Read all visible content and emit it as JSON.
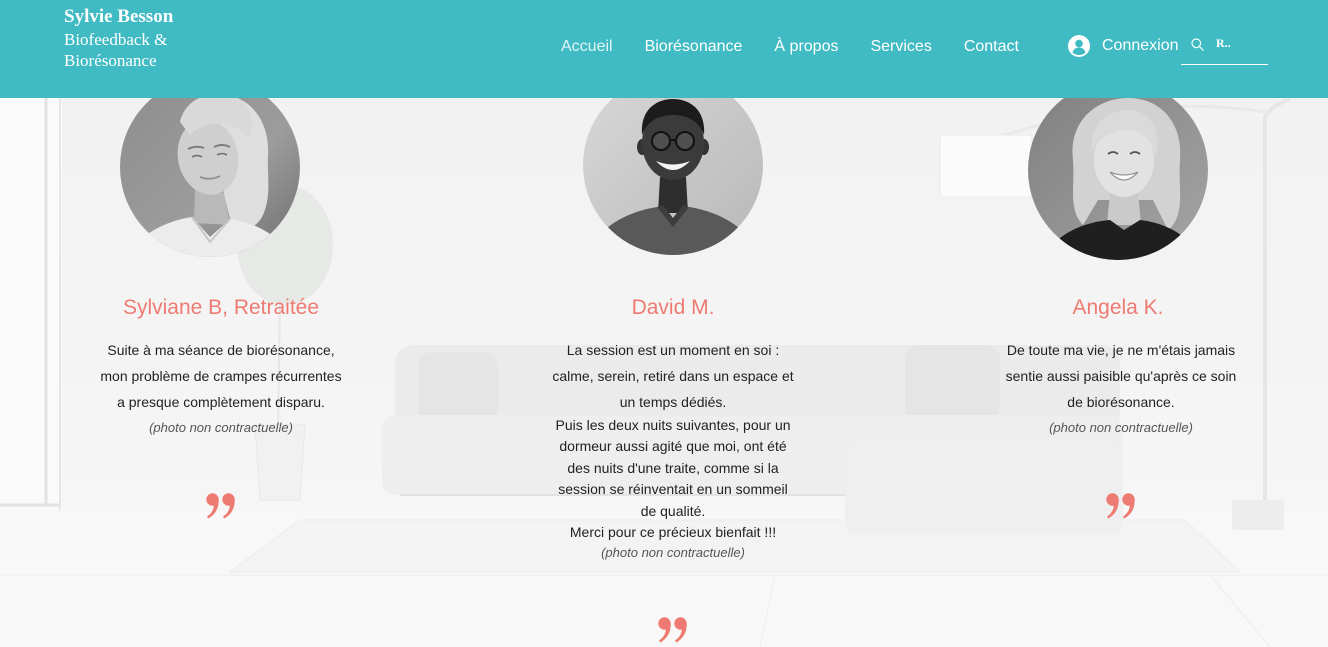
{
  "colors": {
    "header_background": "#40BBC3",
    "accent": "#EE7B72",
    "text": "#222222",
    "note": "#555555"
  },
  "header": {
    "site_name": "Sylvie Besson",
    "tagline_line1": "Biofeedback &",
    "tagline_line2": "Biorésonance",
    "nav": [
      {
        "label": "Accueil"
      },
      {
        "label": "Biorésonance"
      },
      {
        "label": "À propos"
      },
      {
        "label": "Services"
      },
      {
        "label": "Contact"
      }
    ],
    "login": {
      "label": "Connexion",
      "icon": "user-avatar-icon"
    },
    "search": {
      "icon": "search-icon",
      "placeholder": "R.."
    }
  },
  "testimonials": [
    {
      "name": "Sylviane B, Retraitée",
      "paragraphs": [
        [
          "Suite à ma séance de biorésonance,",
          "mon problème de crampes récurrentes",
          "a presque complètement disparu."
        ]
      ],
      "note": "(photo non contractuelle)",
      "quote_icon": "closing-quote-icon"
    },
    {
      "name": "David M.",
      "paragraphs": [
        [
          "La session est un moment en soi :",
          "calme, serein, retiré dans un espace et",
          "un temps dédiés."
        ],
        [
          "Puis les deux nuits suivantes, pour un",
          "dormeur aussi agité que moi, ont été",
          "des nuits d'une traite, comme si la",
          "session se réinventait en un sommeil",
          "de qualité."
        ],
        [
          "Merci pour ce précieux bienfait !!!"
        ]
      ],
      "note": "(photo non contractuelle)",
      "quote_icon": "closing-quote-icon"
    },
    {
      "name": "Angela K.",
      "paragraphs": [
        [
          "De toute ma vie, je ne m'étais jamais",
          "sentie aussi paisible qu'après ce soin",
          "de biorésonance."
        ]
      ],
      "note": "(photo non contractuelle)",
      "quote_icon": "closing-quote-icon"
    }
  ]
}
